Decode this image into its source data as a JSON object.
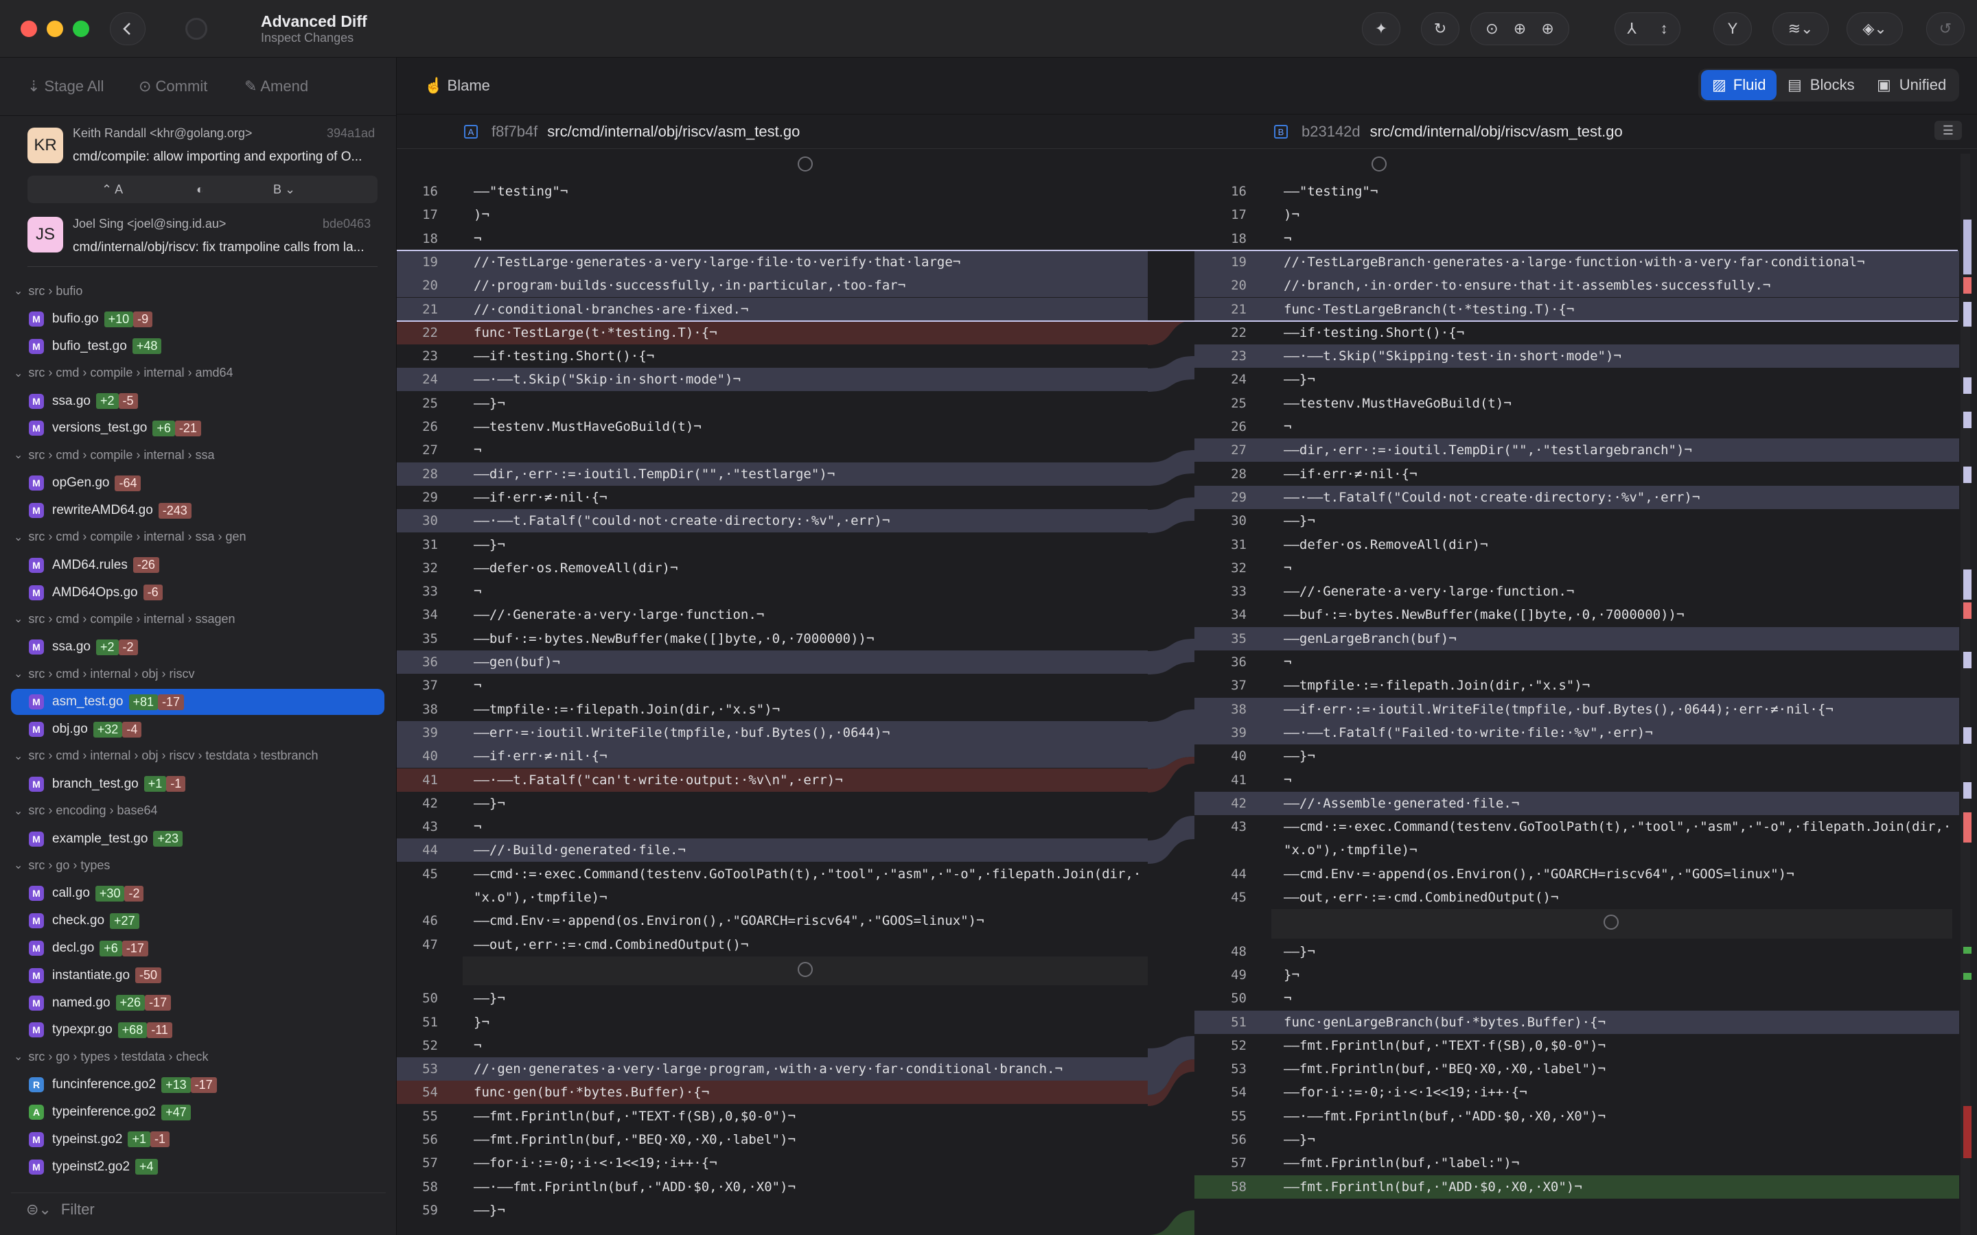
{
  "title": {
    "app": "Advanced Diff",
    "subtitle": "Inspect Changes"
  },
  "colors": {
    "accent": "#1c5fd6",
    "added": "#3e7b3e",
    "removed": "#8a4e4a",
    "modified_band": "#3b3c4c",
    "deleted_band": "#4c2a2a"
  },
  "toolbar_icons": [
    "magic-wand-icon",
    "refresh-icon",
    "fetch-icon",
    "pull-icon",
    "push-icon",
    "merge-icon",
    "branch-icon",
    "fork-icon",
    "stash-menu-icon",
    "layers-menu-icon",
    "undo-icon"
  ],
  "actions": {
    "stage_all": "Stage All",
    "commit": "Commit",
    "amend": "Amend"
  },
  "commits": [
    {
      "initials": "KR",
      "author": "Keith Randall <khr@golang.org>",
      "hash": "394a1ad",
      "message": "cmd/compile: allow importing and exporting of O..."
    },
    {
      "initials": "JS",
      "author": "Joel Sing <joel@sing.id.au>",
      "hash": "bde0463",
      "message": "cmd/internal/obj/riscv: fix trampoline calls from la..."
    }
  ],
  "ab": {
    "a": "A",
    "b": "B"
  },
  "groups": [
    {
      "path": "src › bufio",
      "files": [
        {
          "b": "M",
          "name": "bufio.go",
          "add": "+10",
          "del": "-9"
        },
        {
          "b": "M",
          "name": "bufio_test.go",
          "add": "+48",
          "del": ""
        }
      ]
    },
    {
      "path": "src › cmd › compile › internal › amd64",
      "files": [
        {
          "b": "M",
          "name": "ssa.go",
          "add": "+2",
          "del": "-5"
        },
        {
          "b": "M",
          "name": "versions_test.go",
          "add": "+6",
          "del": "-21"
        }
      ]
    },
    {
      "path": "src › cmd › compile › internal › ssa",
      "files": [
        {
          "b": "M",
          "name": "opGen.go",
          "add": "",
          "del": "-64"
        },
        {
          "b": "M",
          "name": "rewriteAMD64.go",
          "add": "",
          "del": "-243"
        }
      ]
    },
    {
      "path": "src › cmd › compile › internal › ssa › gen",
      "files": [
        {
          "b": "M",
          "name": "AMD64.rules",
          "add": "",
          "del": "-26"
        },
        {
          "b": "M",
          "name": "AMD64Ops.go",
          "add": "",
          "del": "-6"
        }
      ]
    },
    {
      "path": "src › cmd › compile › internal › ssagen",
      "files": [
        {
          "b": "M",
          "name": "ssa.go",
          "add": "+2",
          "del": "-2"
        }
      ]
    },
    {
      "path": "src › cmd › internal › obj › riscv",
      "files": [
        {
          "b": "M",
          "name": "asm_test.go",
          "add": "+81",
          "del": "-17",
          "sel": true
        },
        {
          "b": "M",
          "name": "obj.go",
          "add": "+32",
          "del": "-4"
        }
      ]
    },
    {
      "path": "src › cmd › internal › obj › riscv › testdata › testbranch",
      "files": [
        {
          "b": "M",
          "name": "branch_test.go",
          "add": "+1",
          "del": "-1"
        }
      ]
    },
    {
      "path": "src › encoding › base64",
      "files": [
        {
          "b": "M",
          "name": "example_test.go",
          "add": "+23",
          "del": ""
        }
      ]
    },
    {
      "path": "src › go › types",
      "files": [
        {
          "b": "M",
          "name": "call.go",
          "add": "+30",
          "del": "-2"
        },
        {
          "b": "M",
          "name": "check.go",
          "add": "+27",
          "del": ""
        },
        {
          "b": "M",
          "name": "decl.go",
          "add": "+6",
          "del": "-17"
        },
        {
          "b": "M",
          "name": "instantiate.go",
          "add": "",
          "del": "-50"
        },
        {
          "b": "M",
          "name": "named.go",
          "add": "+26",
          "del": "-17"
        },
        {
          "b": "M",
          "name": "typexpr.go",
          "add": "+68",
          "del": "-11"
        }
      ]
    },
    {
      "path": "src › go › types › testdata › check",
      "files": [
        {
          "b": "R",
          "name": "funcinference.go2",
          "add": "+13",
          "del": "-17"
        },
        {
          "b": "A",
          "name": "typeinference.go2",
          "add": "+47",
          "del": ""
        },
        {
          "b": "M",
          "name": "typeinst.go2",
          "add": "+1",
          "del": "-1"
        },
        {
          "b": "M",
          "name": "typeinst2.go2",
          "add": "+4",
          "del": ""
        }
      ]
    }
  ],
  "filter": "Filter",
  "blame": "Blame",
  "view_modes": {
    "fluid": "Fluid",
    "blocks": "Blocks",
    "unified": "Unified"
  },
  "left_file": {
    "tag": "A",
    "hash": "f8f7b4f",
    "path": "src/cmd/internal/obj/riscv/asm_test.go"
  },
  "right_file": {
    "tag": "B",
    "hash": "b23142d",
    "path": "src/cmd/internal/obj/riscv/asm_test.go"
  },
  "left_lines": [
    {
      "n": "16",
      "t": "——\"testing\"¬"
    },
    {
      "n": "17",
      "t": ")¬"
    },
    {
      "n": "18",
      "t": "¬"
    },
    {
      "n": "19",
      "t": "//·TestLarge·generates·a·very·large·file·to·verify·that·large¬",
      "c": "m"
    },
    {
      "n": "20",
      "t": "//·program·builds·successfully,·in·particular,·too-far¬",
      "c": "m"
    },
    {
      "n": "21",
      "t": "//·conditional·branches·are·fixed.¬",
      "c": "m"
    },
    {
      "n": "22",
      "t": "func·TestLarge(t·*testing.T)·{¬",
      "c": "d"
    },
    {
      "n": "23",
      "t": "——if·testing.Short()·{¬"
    },
    {
      "n": "24",
      "t": "——·——t.Skip(\"Skip·in·short·mode\")¬",
      "c": "m"
    },
    {
      "n": "25",
      "t": "——}¬"
    },
    {
      "n": "26",
      "t": "——testenv.MustHaveGoBuild(t)¬"
    },
    {
      "n": "27",
      "t": "¬"
    },
    {
      "n": "28",
      "t": "——dir,·err·:=·ioutil.TempDir(\"\",·\"testlarge\")¬",
      "c": "m"
    },
    {
      "n": "29",
      "t": "——if·err·≠·nil·{¬"
    },
    {
      "n": "30",
      "t": "——·——t.Fatalf(\"could·not·create·directory:·%v\",·err)¬",
      "c": "m"
    },
    {
      "n": "31",
      "t": "——}¬"
    },
    {
      "n": "32",
      "t": "——defer·os.RemoveAll(dir)¬"
    },
    {
      "n": "33",
      "t": "¬"
    },
    {
      "n": "34",
      "t": "——//·Generate·a·very·large·function.¬"
    },
    {
      "n": "35",
      "t": "——buf·:=·bytes.NewBuffer(make([]byte,·0,·7000000))¬"
    },
    {
      "n": "36",
      "t": "——gen(buf)¬",
      "c": "m"
    },
    {
      "n": "37",
      "t": "¬"
    },
    {
      "n": "38",
      "t": "——tmpfile·:=·filepath.Join(dir,·\"x.s\")¬"
    },
    {
      "n": "39",
      "t": "——err·=·ioutil.WriteFile(tmpfile,·buf.Bytes(),·0644)¬",
      "c": "m"
    },
    {
      "n": "40",
      "t": "——if·err·≠·nil·{¬",
      "c": "m"
    },
    {
      "n": "41",
      "t": "——·——t.Fatalf(\"can't·write·output:·%v\\n\",·err)¬",
      "c": "d"
    },
    {
      "n": "42",
      "t": "——}¬"
    },
    {
      "n": "43",
      "t": "¬"
    },
    {
      "n": "44",
      "t": "——//·Build·generated·file.¬",
      "c": "m"
    },
    {
      "n": "45",
      "t": "——cmd·:=·exec.Command(testenv.GoToolPath(t),·\"tool\",·\"asm\",·\"-o\",·filepath.Join(dir,·"
    },
    {
      "n": "",
      "t": "\"x.o\"),·tmpfile)¬"
    },
    {
      "n": "46",
      "t": "——cmd.Env·=·append(os.Environ(),·\"GOARCH=riscv64\",·\"GOOS=linux\")¬"
    },
    {
      "n": "47",
      "t": "——out,·err·:=·cmd.CombinedOutput()¬"
    },
    {
      "n": "",
      "t": "",
      "c": "gap"
    },
    {
      "n": "50",
      "t": "——}¬"
    },
    {
      "n": "51",
      "t": "}¬"
    },
    {
      "n": "52",
      "t": "¬"
    },
    {
      "n": "53",
      "t": "//·gen·generates·a·very·large·program,·with·a·very·far·conditional·branch.¬",
      "c": "m"
    },
    {
      "n": "54",
      "t": "func·gen(buf·*bytes.Buffer)·{¬",
      "c": "d"
    },
    {
      "n": "55",
      "t": "——fmt.Fprintln(buf,·\"TEXT·f(SB),0,$0-0\")¬"
    },
    {
      "n": "56",
      "t": "——fmt.Fprintln(buf,·\"BEQ·X0,·X0,·label\")¬"
    },
    {
      "n": "57",
      "t": "——for·i·:=·0;·i·<·1<<19;·i++·{¬"
    },
    {
      "n": "58",
      "t": "——·——fmt.Fprintln(buf,·\"ADD·$0,·X0,·X0\")¬"
    },
    {
      "n": "59",
      "t": "——}¬"
    }
  ],
  "right_lines": [
    {
      "n": "16",
      "t": "——\"testing\"¬"
    },
    {
      "n": "17",
      "t": ")¬"
    },
    {
      "n": "18",
      "t": "¬"
    },
    {
      "n": "19",
      "t": "//·TestLargeBranch·generates·a·large·function·with·a·very·far·conditional¬",
      "c": "m"
    },
    {
      "n": "20",
      "t": "//·branch,·in·order·to·ensure·that·it·assembles·successfully.¬",
      "c": "m"
    },
    {
      "n": "21",
      "t": "func·TestLargeBranch(t·*testing.T)·{¬",
      "c": "m"
    },
    {
      "n": "22",
      "t": "——if·testing.Short()·{¬"
    },
    {
      "n": "23",
      "t": "——·——t.Skip(\"Skipping·test·in·short·mode\")¬",
      "c": "m"
    },
    {
      "n": "24",
      "t": "——}¬"
    },
    {
      "n": "25",
      "t": "——testenv.MustHaveGoBuild(t)¬"
    },
    {
      "n": "26",
      "t": "¬"
    },
    {
      "n": "27",
      "t": "——dir,·err·:=·ioutil.TempDir(\"\",·\"testlargebranch\")¬",
      "c": "m"
    },
    {
      "n": "28",
      "t": "——if·err·≠·nil·{¬"
    },
    {
      "n": "29",
      "t": "——·——t.Fatalf(\"Could·not·create·directory:·%v\",·err)¬",
      "c": "m"
    },
    {
      "n": "30",
      "t": "——}¬"
    },
    {
      "n": "31",
      "t": "——defer·os.RemoveAll(dir)¬"
    },
    {
      "n": "32",
      "t": "¬"
    },
    {
      "n": "33",
      "t": "——//·Generate·a·very·large·function.¬"
    },
    {
      "n": "34",
      "t": "——buf·:=·bytes.NewBuffer(make([]byte,·0,·7000000))¬"
    },
    {
      "n": "35",
      "t": "——genLargeBranch(buf)¬",
      "c": "m"
    },
    {
      "n": "36",
      "t": "¬"
    },
    {
      "n": "37",
      "t": "——tmpfile·:=·filepath.Join(dir,·\"x.s\")¬"
    },
    {
      "n": "38",
      "t": "——if·err·:=·ioutil.WriteFile(tmpfile,·buf.Bytes(),·0644);·err·≠·nil·{¬",
      "c": "m"
    },
    {
      "n": "39",
      "t": "——·——t.Fatalf(\"Failed·to·write·file:·%v\",·err)¬",
      "c": "m"
    },
    {
      "n": "40",
      "t": "——}¬"
    },
    {
      "n": "41",
      "t": "¬"
    },
    {
      "n": "42",
      "t": "——//·Assemble·generated·file.¬",
      "c": "m"
    },
    {
      "n": "43",
      "t": "——cmd·:=·exec.Command(testenv.GoToolPath(t),·\"tool\",·\"asm\",·\"-o\",·filepath.Join(dir,·"
    },
    {
      "n": "",
      "t": "\"x.o\"),·tmpfile)¬"
    },
    {
      "n": "44",
      "t": "——cmd.Env·=·append(os.Environ(),·\"GOARCH=riscv64\",·\"GOOS=linux\")¬"
    },
    {
      "n": "45",
      "t": "——out,·err·:=·cmd.CombinedOutput()¬"
    },
    {
      "n": "",
      "t": "",
      "c": "gap"
    },
    {
      "n": "48",
      "t": "——}¬"
    },
    {
      "n": "49",
      "t": "}¬"
    },
    {
      "n": "50",
      "t": "¬"
    },
    {
      "n": "51",
      "t": "func·genLargeBranch(buf·*bytes.Buffer)·{¬",
      "c": "m"
    },
    {
      "n": "52",
      "t": "——fmt.Fprintln(buf,·\"TEXT·f(SB),0,$0-0\")¬"
    },
    {
      "n": "53",
      "t": "——fmt.Fprintln(buf,·\"BEQ·X0,·X0,·label\")¬"
    },
    {
      "n": "54",
      "t": "——for·i·:=·0;·i·<·1<<19;·i++·{¬"
    },
    {
      "n": "55",
      "t": "——·——fmt.Fprintln(buf,·\"ADD·$0,·X0,·X0\")¬"
    },
    {
      "n": "56",
      "t": "——}¬"
    },
    {
      "n": "57",
      "t": "——fmt.Fprintln(buf,·\"label:\")¬"
    },
    {
      "n": "58",
      "t": "——fmt.Fprintln(buf,·\"ADD·$0,·X0,·X0\")¬",
      "c": "a"
    }
  ]
}
